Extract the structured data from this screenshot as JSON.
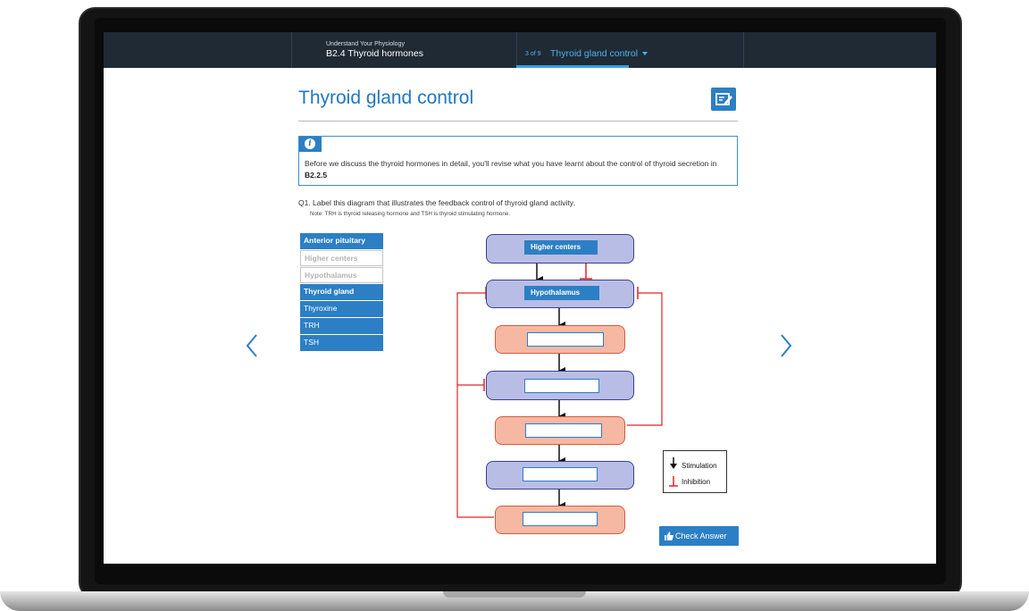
{
  "header": {
    "course_subtitle": "Understand Your Physiology",
    "course_title": "B2.4 Thyroid hormones",
    "page_count": "3 of 9",
    "page_title": "Thyroid gland control"
  },
  "main": {
    "heading": "Thyroid gland control",
    "info_text_before": "Before we discuss the thyroid hormones in detail, you'll revise what you have learnt about the control of thyroid secretion in ",
    "info_text_bold": "B2.2.5",
    "question": "Q1. Label this diagram that illustrates the feedback control of thyroid gland activity.",
    "note": "Note: TRH is thyroid releasing hormone and TSH is thyroid stimulating hormone."
  },
  "labels": [
    {
      "text": "Anterior pituitary",
      "state": "bold"
    },
    {
      "text": "Higher centers",
      "state": "used"
    },
    {
      "text": "Hypothalamus",
      "state": "used"
    },
    {
      "text": "Thyroid gland",
      "state": "bold"
    },
    {
      "text": "Thyroxine",
      "state": "normal"
    },
    {
      "text": "TRH",
      "state": "normal"
    },
    {
      "text": "TSH",
      "state": "normal"
    }
  ],
  "diagram": {
    "slot_higher_centers": "Higher centers",
    "slot_hypothalamus": "Hypothalamus",
    "legend_stimulation": "Stimulation",
    "legend_inhibition": "Inhibition",
    "colors": {
      "stimulation": "#111111",
      "inhibition": "#e02424",
      "gland_box": "#b8bde6",
      "hormone_box": "#f6b8a3"
    }
  },
  "actions": {
    "check_answer": "Check Answer"
  },
  "icons": [
    "info-icon",
    "edit-icon",
    "chevron-left-icon",
    "chevron-right-icon",
    "thumbs-up-icon",
    "caret-down-icon"
  ]
}
